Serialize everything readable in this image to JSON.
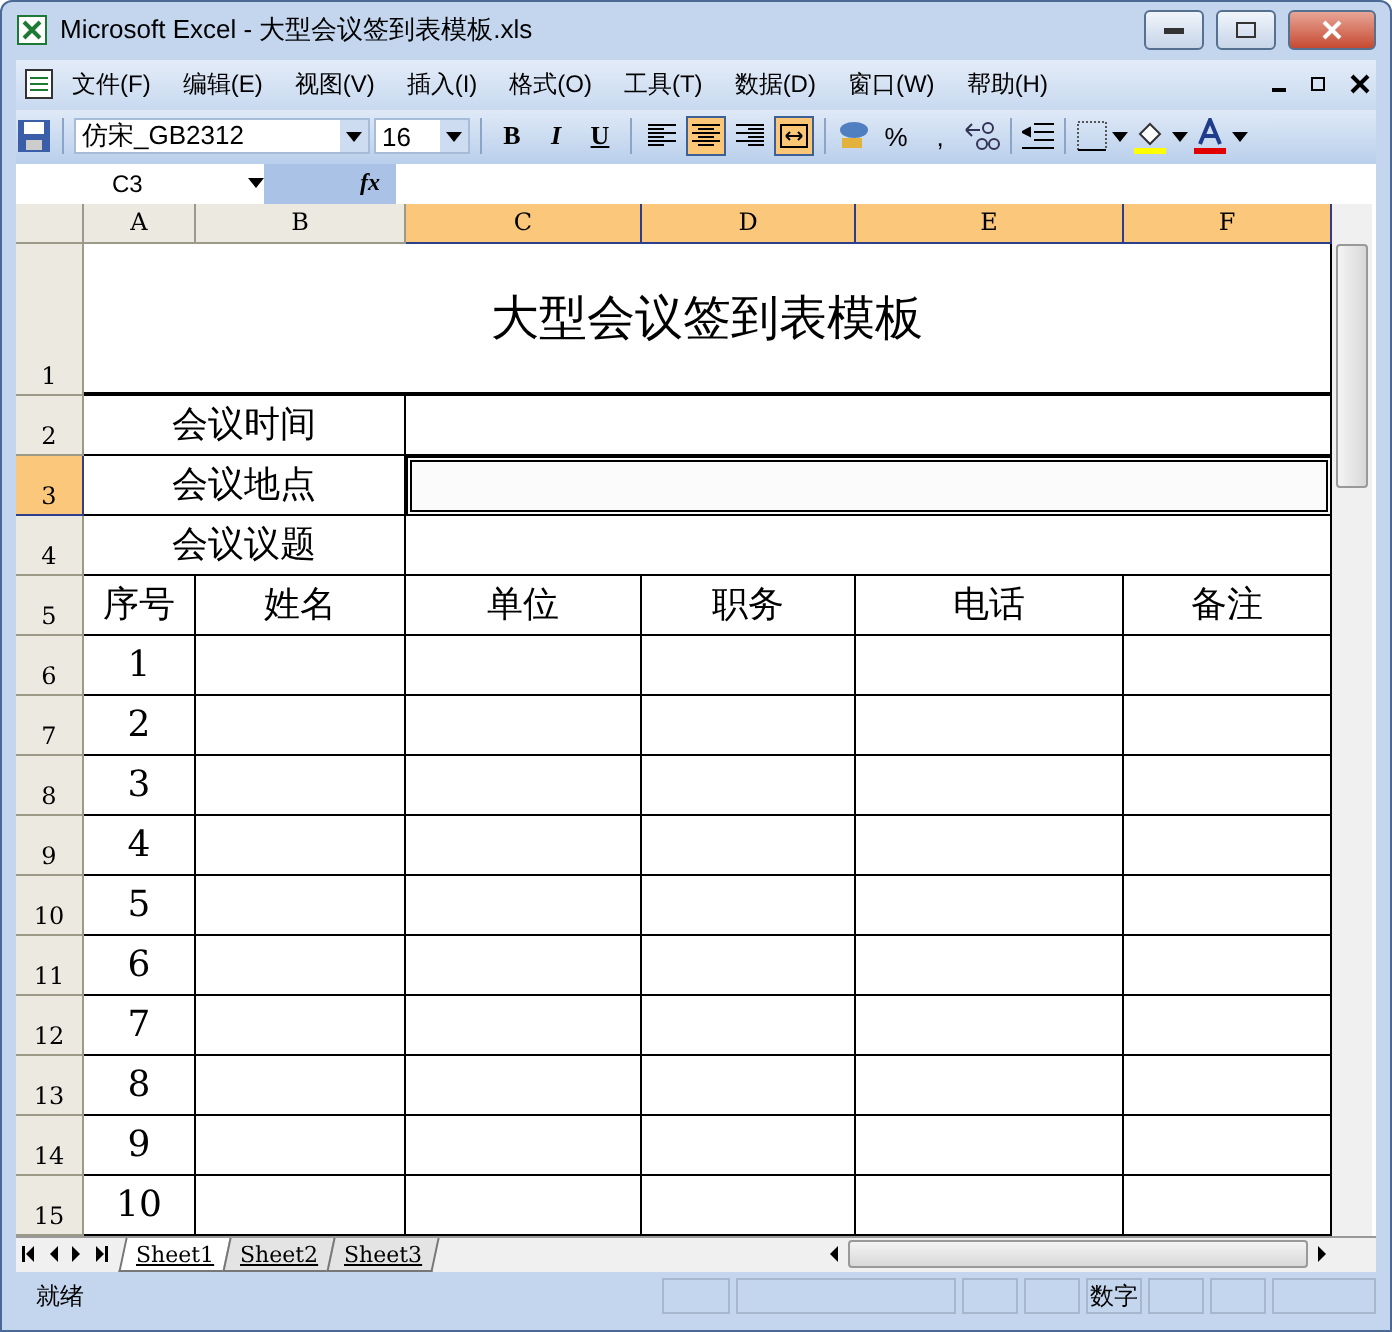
{
  "window": {
    "title": "Microsoft Excel - 大型会议签到表模板.xls"
  },
  "menu": [
    "文件(F)",
    "编辑(E)",
    "视图(V)",
    "插入(I)",
    "格式(O)",
    "工具(T)",
    "数据(D)",
    "窗口(W)",
    "帮助(H)"
  ],
  "toolbar": {
    "font": "仿宋_GB2312",
    "size": "16",
    "format_buttons": [
      {
        "label": "B",
        "selected": false
      },
      {
        "label": "I",
        "selected": false
      },
      {
        "label": "U",
        "selected": false
      }
    ],
    "alignment_buttons": [
      {
        "selected": false
      },
      {
        "selected": true
      },
      {
        "selected": false
      },
      {
        "selected": true
      }
    ],
    "number_buttons": [
      "%",
      ","
    ]
  },
  "formula_bar": {
    "name_box": "C3",
    "fx": "fx"
  },
  "columns": [
    {
      "label": "A",
      "selected": false
    },
    {
      "label": "B",
      "selected": false
    },
    {
      "label": "C",
      "selected": true
    },
    {
      "label": "D",
      "selected": true
    },
    {
      "label": "E",
      "selected": true
    },
    {
      "label": "F",
      "selected": true
    }
  ],
  "rows": [
    {
      "label": "1",
      "selected": false
    },
    {
      "label": "2",
      "selected": false
    },
    {
      "label": "3",
      "selected": true
    },
    {
      "label": "4",
      "selected": false
    },
    {
      "label": "5",
      "selected": false
    },
    {
      "label": "6",
      "selected": false
    },
    {
      "label": "7",
      "selected": false
    },
    {
      "label": "8",
      "selected": false
    },
    {
      "label": "9",
      "selected": false
    },
    {
      "label": "10",
      "selected": false
    },
    {
      "label": "11",
      "selected": false
    },
    {
      "label": "12",
      "selected": false
    },
    {
      "label": "13",
      "selected": false
    },
    {
      "label": "14",
      "selected": false
    },
    {
      "label": "15",
      "selected": false
    }
  ],
  "sheet": {
    "title": "大型会议签到表模板",
    "info_rows": [
      {
        "label": "会议时间",
        "selected": false
      },
      {
        "label": "会议地点",
        "selected": true
      },
      {
        "label": "会议议题",
        "selected": false
      }
    ],
    "table_header": [
      "序号",
      "姓名",
      "单位",
      "职务",
      "电话",
      "备注"
    ],
    "numbers": [
      "1",
      "2",
      "3",
      "4",
      "5",
      "6",
      "7",
      "8",
      "9",
      "10"
    ]
  },
  "sheet_tabs": [
    {
      "label": "Sheet1",
      "selected": true
    },
    {
      "label": "Sheet2",
      "selected": false
    },
    {
      "label": "Sheet3",
      "selected": false
    }
  ],
  "status_bar": {
    "status": "就绪",
    "mode": "数字"
  }
}
